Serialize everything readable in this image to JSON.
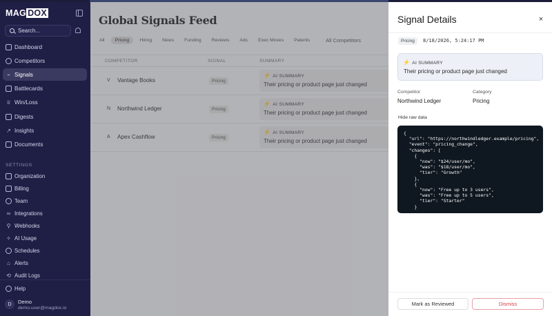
{
  "brand": {
    "part1": "MAG",
    "part2": "DOX"
  },
  "sidebar": {
    "search_label": "Search...",
    "nav": [
      {
        "label": "Dashboard",
        "icon": "grid-icon"
      },
      {
        "label": "Competitors",
        "icon": "users-icon"
      },
      {
        "label": "Signals",
        "icon": "signal-icon",
        "active": true
      },
      {
        "label": "Battlecards",
        "icon": "battlecard-icon"
      },
      {
        "label": "Win/Loss",
        "icon": "trophy-icon"
      },
      {
        "label": "Digests",
        "icon": "digest-icon"
      },
      {
        "label": "Insights",
        "icon": "trend-icon"
      },
      {
        "label": "Documents",
        "icon": "folder-icon"
      }
    ],
    "settings_title": "SETTINGS",
    "settings": [
      {
        "label": "Organization",
        "icon": "building-icon"
      },
      {
        "label": "Billing",
        "icon": "card-icon"
      },
      {
        "label": "Team",
        "icon": "team-icon"
      },
      {
        "label": "Integrations",
        "icon": "link-icon"
      },
      {
        "label": "Webhooks",
        "icon": "webhook-icon"
      },
      {
        "label": "AI Usage",
        "icon": "sparkle-icon"
      },
      {
        "label": "Schedules",
        "icon": "clock-icon"
      },
      {
        "label": "Alerts",
        "icon": "alert-icon"
      },
      {
        "label": "Audit Logs",
        "icon": "log-icon"
      }
    ],
    "help": "Help",
    "user": {
      "initial": "D",
      "name": "Demo",
      "email": "demo.user@magdox.io"
    }
  },
  "main": {
    "title": "Global Signals Feed",
    "tabs": [
      "All",
      "Pricing",
      "Hiring",
      "News",
      "Funding",
      "Reviews",
      "Ads",
      "Exec Moves",
      "Patents"
    ],
    "active_tab": "Pricing",
    "competitor_filter": "All Competitors",
    "columns": [
      "COMPETITOR",
      "SIGNAL",
      "SUMMARY"
    ],
    "rows": [
      {
        "initial": "V",
        "competitor": "Vantage Books",
        "signal": "Pricing",
        "summary_label": "AI SUMMARY",
        "summary": "Their pricing or product page just changed"
      },
      {
        "initial": "N",
        "competitor": "Northwind Ledger",
        "signal": "Pricing",
        "summary_label": "AI SUMMARY",
        "summary": "Their pricing or product page just changed"
      },
      {
        "initial": "A",
        "competitor": "Apex Cashflow",
        "signal": "Pricing",
        "summary_label": "AI SUMMARY",
        "summary": "Their pricing or product page just changed"
      }
    ]
  },
  "panel": {
    "title": "Signal Details",
    "close": "×",
    "badge": "Pricing",
    "timestamp": "8/18/2026, 5:24:17 PM",
    "ai_label": "AI SUMMARY",
    "ai_text": "Their pricing or product page just changed",
    "competitor_label": "Competitor",
    "competitor_value": "Northwind Ledger",
    "category_label": "Category",
    "category_value": "Pricing",
    "raw_toggle": "Hide raw data",
    "raw_json": "{\n  \"url\": \"https://northwindledger.example/pricing\",\n  \"event\": \"pricing_change\",\n  \"changes\": [\n    {\n      \"now\": \"$24/user/mo\",\n      \"was\": \"$18/user/mo\",\n      \"tier\": \"Growth\"\n    },\n    {\n      \"now\": \"Free up to 3 users\",\n      \"was\": \"Free up to 5 users\",\n      \"tier\": \"Starter\"\n    }",
    "btn_review": "Mark as Reviewed",
    "btn_dismiss": "Dismiss"
  },
  "colors": {
    "sidebar_bg": "#1f1e45",
    "active_nav_bg": "#3a3a60",
    "panel_bg": "#ffffff",
    "code_bg": "#0f1720",
    "dismiss": "#d0404e"
  }
}
